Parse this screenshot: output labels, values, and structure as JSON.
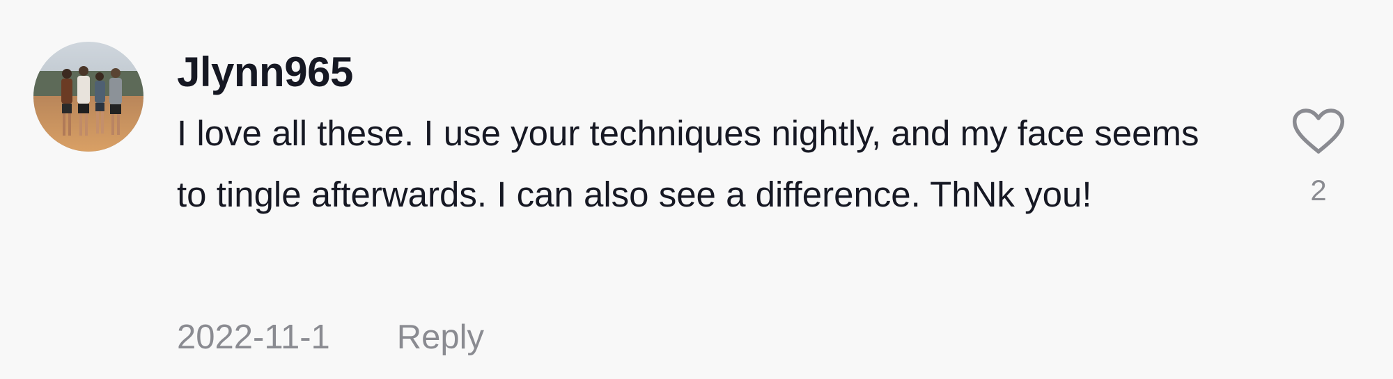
{
  "comment": {
    "username": "Jlynn965",
    "text": "I love all these. I use your techniques nightly, and my face seems to tingle afterwards. I can also see a difference. ThNk you!",
    "date": "2022-11-1",
    "reply_label": "Reply",
    "like_count": "2",
    "avatar_icon": "user-photo-avatar",
    "like_icon": "heart-outline-icon"
  },
  "colors": {
    "background": "#f8f8f8",
    "text_primary": "#161823",
    "text_secondary": "#8a8b91",
    "icon": "#8a8b91"
  }
}
